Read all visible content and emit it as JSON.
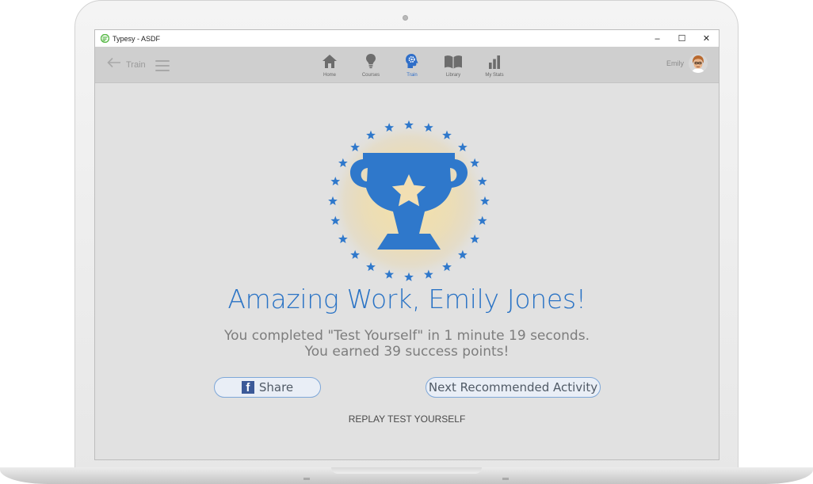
{
  "window": {
    "title": "Typesy - ASDF",
    "controls": {
      "minimize": "–",
      "maximize": "☐",
      "close": "✕"
    }
  },
  "navbar": {
    "back_label": "Train",
    "items": [
      {
        "label": "Home",
        "icon": "home-icon"
      },
      {
        "label": "Courses",
        "icon": "lightbulb-icon"
      },
      {
        "label": "Train",
        "icon": "brain-gear-icon",
        "active": true
      },
      {
        "label": "Library",
        "icon": "book-icon"
      },
      {
        "label": "My Stats",
        "icon": "bar-chart-icon"
      }
    ],
    "user_name": "Emily"
  },
  "main": {
    "headline": "Amazing Work, Emily Jones!",
    "summary_line1": "You completed \"Test Yourself\" in 1 minute 19 seconds.",
    "summary_line2": "You earned 39 success points!",
    "share_label": "Share",
    "next_label": "Next Recommended Activity",
    "replay_label": "REPLAY TEST YOURSELF"
  },
  "colors": {
    "accent": "#2a73c5",
    "trophy": "#2f78cb",
    "star_inner": "#f4ddb0",
    "glow": "#f2d27a",
    "facebook": "#3b5998"
  }
}
